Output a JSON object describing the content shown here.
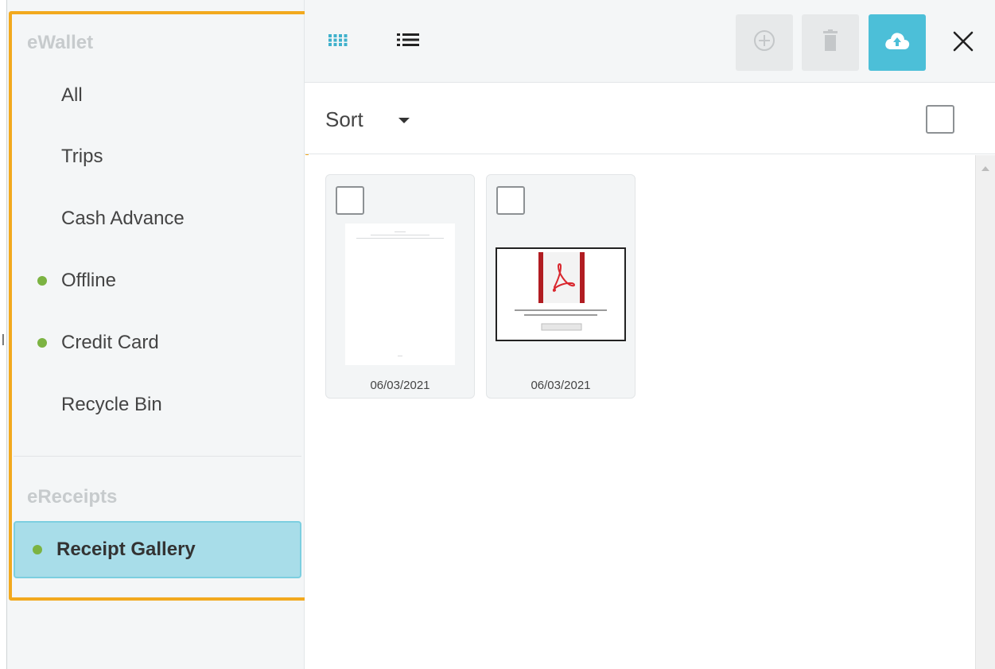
{
  "sidebar": {
    "sections": [
      {
        "heading": "eWallet"
      },
      {
        "heading": "eReceipts"
      }
    ],
    "items": [
      {
        "label": "All",
        "status_dot": false
      },
      {
        "label": "Trips",
        "status_dot": false
      },
      {
        "label": "Cash Advance",
        "status_dot": false
      },
      {
        "label": "Offline",
        "status_dot": true
      },
      {
        "label": "Credit Card",
        "status_dot": true
      },
      {
        "label": "Recycle Bin",
        "status_dot": false
      },
      {
        "label": "Receipt Gallery",
        "status_dot": true,
        "active": true
      }
    ],
    "status_dot_color": "#7cb342",
    "highlight_color": "#f2a91e",
    "active_item_color": "#a8dde9"
  },
  "toolbar": {
    "view_buttons": [
      {
        "icon": "grid-view-icon",
        "active": true
      },
      {
        "icon": "list-view-icon",
        "active": false
      }
    ],
    "actions": [
      {
        "icon": "add-circle-icon",
        "enabled": false
      },
      {
        "icon": "trash-icon",
        "enabled": false
      },
      {
        "icon": "cloud-upload-icon",
        "enabled": true
      }
    ],
    "close_icon": "close-icon",
    "accent_color": "#4cbfd8"
  },
  "sort": {
    "label": "Sort"
  },
  "gallery": {
    "cards": [
      {
        "date": "06/03/2021",
        "thumbnail": "blank-document"
      },
      {
        "date": "06/03/2021",
        "thumbnail": "pdf-document"
      }
    ]
  }
}
